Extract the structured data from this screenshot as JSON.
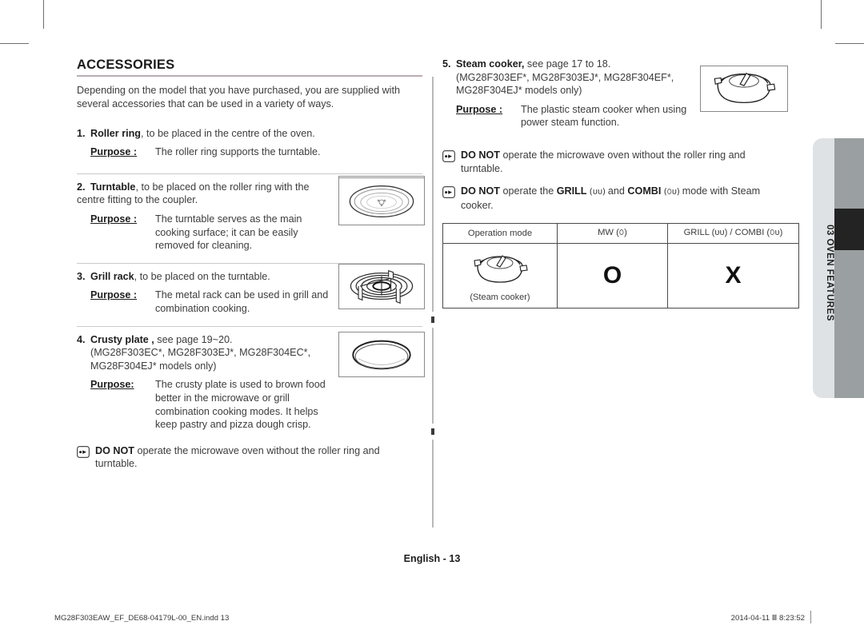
{
  "document": {
    "page_label": "English - 13",
    "side_tab": "03 OVEN FEATURES",
    "footer_left": "MG28F303EAW_EF_DE68-04179L-00_EN.indd   13",
    "footer_right": "2014-04-11   Ⅲ 8:23:52"
  },
  "section": {
    "title": "ACCESSORIES",
    "intro": "Depending on the model that you have purchased, you are supplied with several accessories that can be used in a variety of ways."
  },
  "accessories": [
    {
      "number": "1.",
      "name": "Roller ring",
      "desc": ", to be placed in the centre of the oven.",
      "purpose_label": "Purpose :",
      "purpose_text": "The roller ring supports the turntable.",
      "image": "roller-ring"
    },
    {
      "number": "2.",
      "name": "Turntable",
      "desc": ", to be placed on the roller ring with the centre fitting to the coupler.",
      "purpose_label": "Purpose :",
      "purpose_text": "The turntable serves as the main cooking surface; it can be easily removed for cleaning.",
      "image": "turntable"
    },
    {
      "number": "3.",
      "name": "Grill rack",
      "desc": ", to be placed on the turntable.",
      "purpose_label": "Purpose :",
      "purpose_text": "The metal rack can be used in grill and combination cooking.",
      "image": "grill-rack"
    },
    {
      "number": "4.",
      "name": "Crusty plate ,",
      "desc": " see page 19~20.",
      "models": "(MG28F303EC*, MG28F303EJ*, MG28F304EC*, MG28F304EJ* models only)",
      "purpose_label": "Purpose:",
      "purpose_text": "The crusty plate is used to brown food better in the microwave or grill combination cooking modes. It helps keep pastry and pizza dough crisp.",
      "image": "crusty-plate"
    },
    {
      "number": "5.",
      "name": "Steam cooker,",
      "desc": " see page 17 to 18.",
      "models": "(MG28F303EF*, MG28F303EJ*, MG28F304EF*, MG28F304EJ* models only)",
      "purpose_label": "Purpose :",
      "purpose_text": "The plastic steam cooker when using power steam function.",
      "image": "steam-cooker"
    }
  ],
  "notes": {
    "left_warning": {
      "strong": "DO NOT",
      "text": " operate the microwave oven without the roller ring and turntable."
    },
    "right_warning_1": {
      "strong": "DO NOT",
      "text": " operate the microwave oven without the roller ring and turntable."
    },
    "right_warning_2": {
      "strong_a": "DO NOT",
      "mid_a": " operate the ",
      "strong_b": "GRILL",
      "sym_b": " (ᴜᴜ) ",
      "mid_b": "and ",
      "strong_c": "COMBI",
      "sym_c": " (௦ᴜ) ",
      "tail": "mode with Steam cooker."
    }
  },
  "mode_table": {
    "headers": [
      "Operation mode",
      "MW (௦)",
      "GRILL (ᴜᴜ) / COMBI (௦ᴜ)"
    ],
    "row": {
      "label": "(Steam cooker)",
      "mw": "O",
      "grill_combi": "X"
    }
  }
}
